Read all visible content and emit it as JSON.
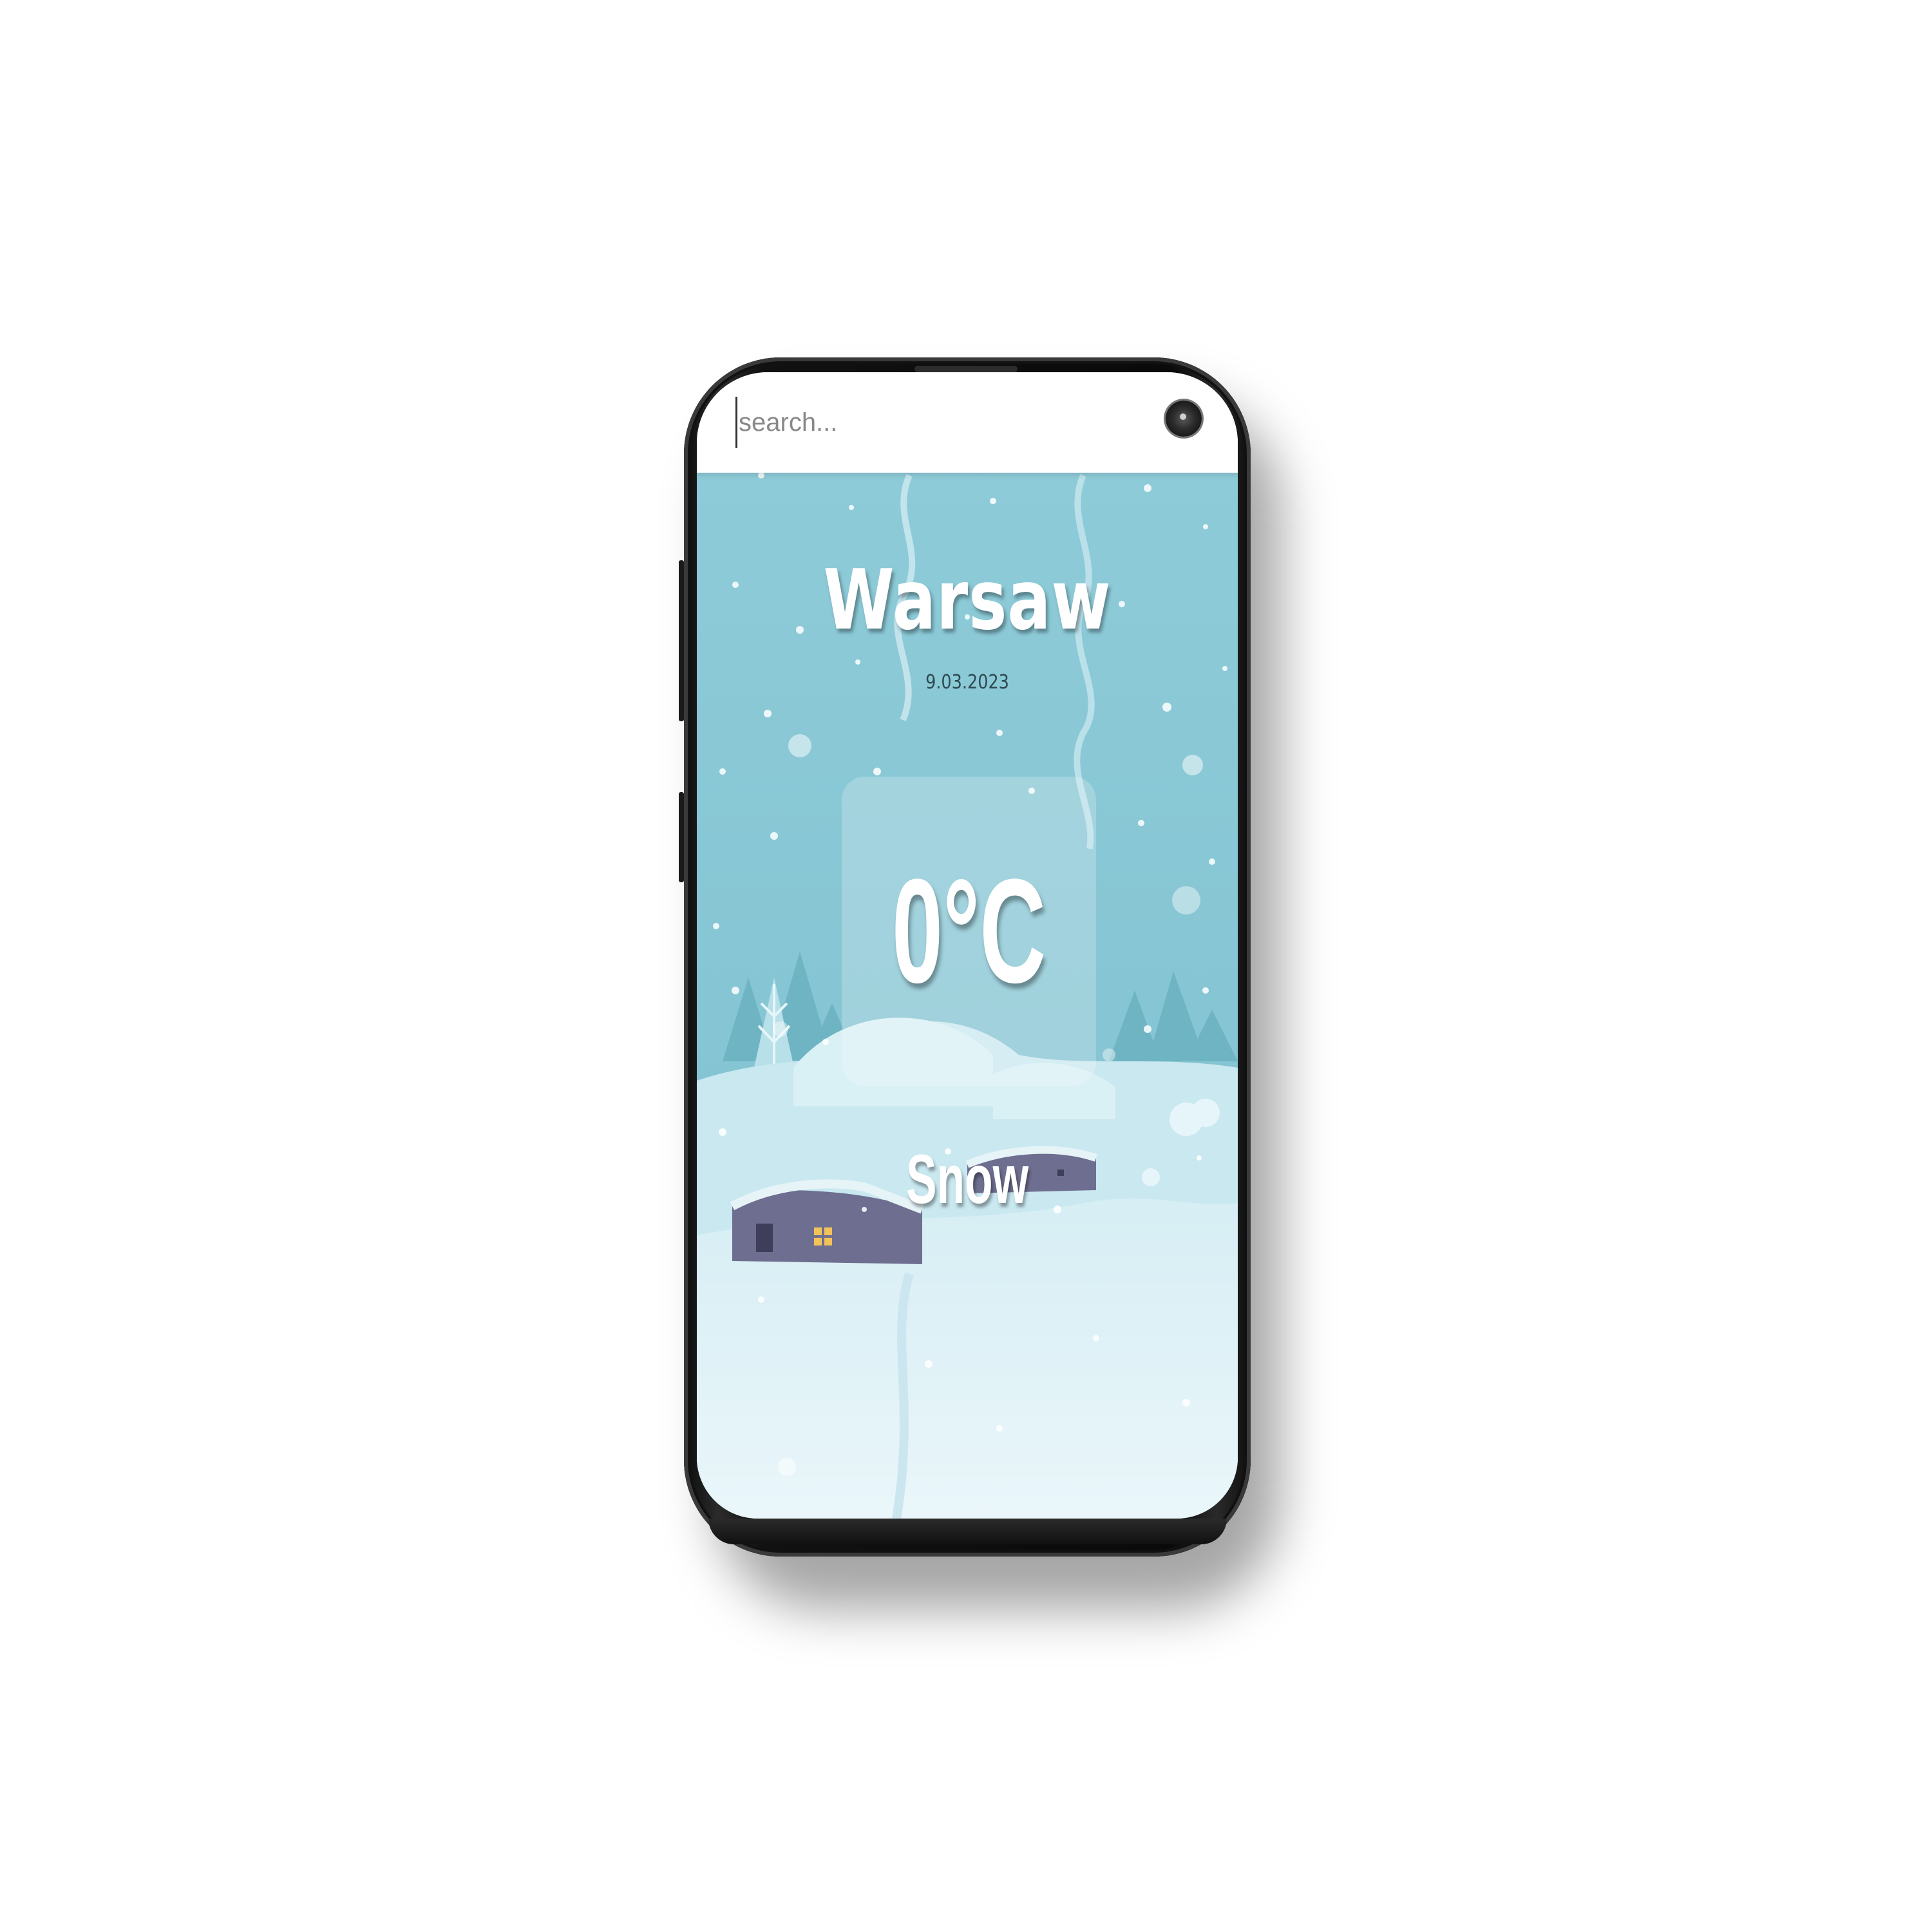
{
  "search": {
    "placeholder": "search..."
  },
  "weather": {
    "city": "Warsaw",
    "date": "9.03.2023",
    "temperature": "0°C",
    "condition": "Snow"
  },
  "colors": {
    "sky": "#88c8d6",
    "snow": "#e4f3f8",
    "house": "#6e6e90"
  },
  "icons": {
    "camera": "camera-icon"
  }
}
